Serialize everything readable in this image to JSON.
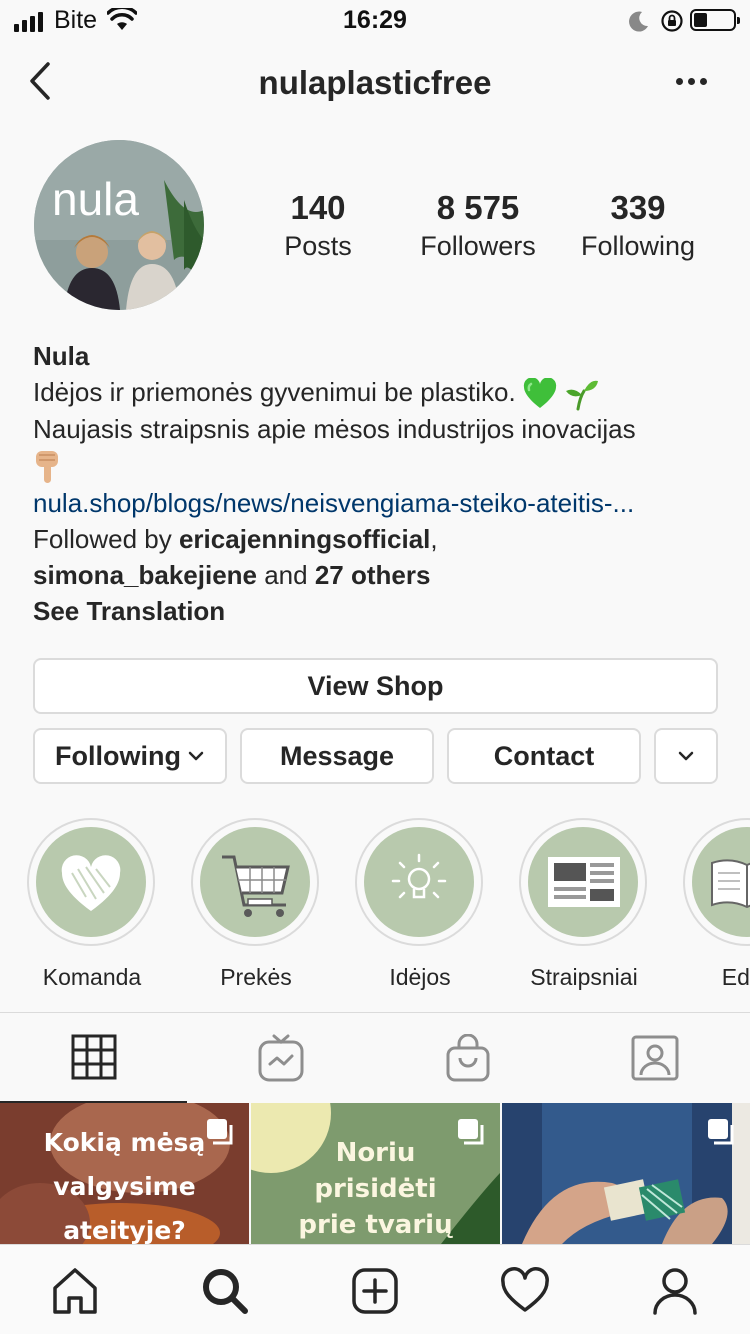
{
  "status_bar": {
    "carrier": "Bite",
    "time": "16:29"
  },
  "header": {
    "username": "nulaplasticfree"
  },
  "profile": {
    "avatar_text": "nula",
    "stats": [
      {
        "value": "140",
        "label": "Posts"
      },
      {
        "value": "8 575",
        "label": "Followers"
      },
      {
        "value": "339",
        "label": "Following"
      }
    ],
    "name": "Nula",
    "bio_line1": "Idėjos ir priemonės gyvenimui be plastiko.",
    "bio_line2": "Naujasis straipsnis apie mėsos industrijos inovacijas",
    "link": "nula.shop/blogs/news/neisvengiama-steiko-ateitis-...",
    "followed_by_prefix": "Followed by ",
    "followed_by_user1": "ericajenningsofficial",
    "followed_by_comma": ",",
    "followed_by_user2": "simona_bakejiene",
    "followed_by_and": " and ",
    "followed_by_others": "27 others",
    "see_translation": "See Translation"
  },
  "actions": {
    "view_shop": "View Shop",
    "following": "Following",
    "message": "Message",
    "contact": "Contact"
  },
  "highlights": [
    {
      "label": "Komanda",
      "icon": "heart-icon"
    },
    {
      "label": "Prekės",
      "icon": "shopping-cart-icon"
    },
    {
      "label": "Idėjos",
      "icon": "lightbulb-icon"
    },
    {
      "label": "Straipsniai",
      "icon": "newspaper-icon"
    },
    {
      "label": "Eduk",
      "icon": "book-icon"
    }
  ],
  "tabs": [
    {
      "name": "grid-icon",
      "active": true
    },
    {
      "name": "igtv-icon",
      "active": false
    },
    {
      "name": "shop-bag-icon",
      "active": false
    },
    {
      "name": "tagged-icon",
      "active": false
    }
  ],
  "posts": [
    {
      "lines": [
        "Kokią mėsą",
        "valgysime",
        "ateityje?"
      ]
    },
    {
      "lines": [
        "Noriu",
        "prisidėti",
        "prie tvarių"
      ]
    },
    {
      "lines": []
    }
  ],
  "bottom_nav": [
    "home-icon",
    "search-icon",
    "new-post-icon",
    "activity-heart-icon",
    "profile-icon"
  ],
  "colors": {
    "link": "#00376b",
    "highlight_bg": "#b8c9ad",
    "text": "#262626",
    "border": "#dbdbdb"
  }
}
